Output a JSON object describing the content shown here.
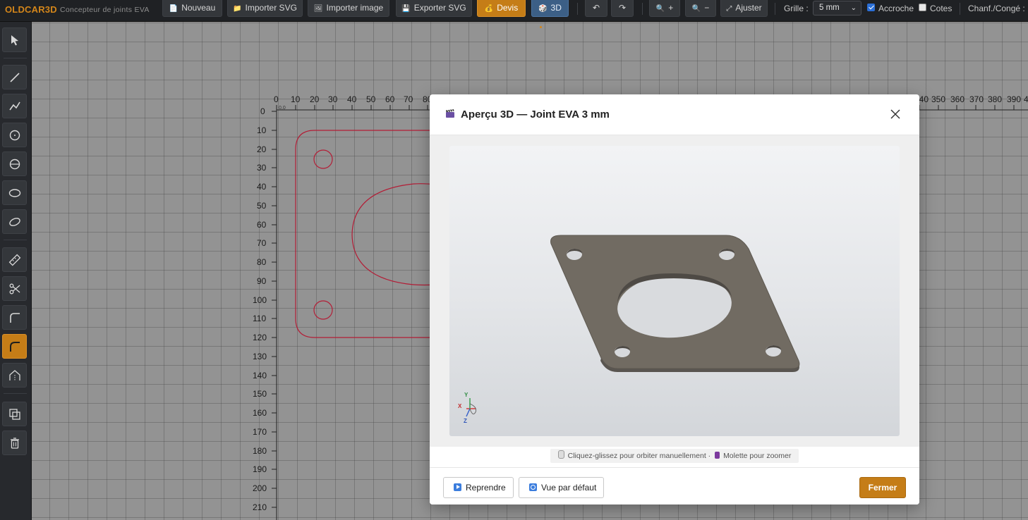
{
  "app": {
    "brand": "OLDCAR3D",
    "subtitle": "Concepteur de joints EVA"
  },
  "toolbar": {
    "new_label": "Nouveau",
    "import_svg_label": "Importer SVG",
    "import_image_label": "Importer image",
    "export_svg_label": "Exporter SVG",
    "quote_label": "Devis",
    "view3d_label": "3D",
    "undo_label": "↶",
    "redo_label": "↷",
    "zoom_in_label": "+",
    "zoom_out_label": "−",
    "fit_label": "Ajuster",
    "grid_label": "Grille :",
    "grid_value": "5 mm",
    "snap_label": "Accroche",
    "snap_checked": true,
    "dims_label": "Cotes",
    "dims_checked": false,
    "chamfer_label": "Chanf./Congé :"
  },
  "sidebar": {
    "tools": [
      {
        "name": "select-tool",
        "icon": "cursor-icon"
      },
      {
        "name": "line-tool",
        "icon": "line-icon"
      },
      {
        "name": "polyline-tool",
        "icon": "polyline-icon"
      },
      {
        "name": "circle-tool",
        "icon": "circle-icon"
      },
      {
        "name": "circle-diameter-tool",
        "icon": "circle-diameter-icon"
      },
      {
        "name": "ellipse-tool",
        "icon": "ellipse-icon"
      },
      {
        "name": "rotated-ellipse-tool",
        "icon": "rotated-ellipse-icon"
      },
      {
        "name": "measure-tool",
        "icon": "ruler-icon"
      },
      {
        "name": "cut-tool",
        "icon": "scissors-icon"
      },
      {
        "name": "fillet-tool",
        "icon": "fillet-icon"
      },
      {
        "name": "round-corner-tool",
        "icon": "round-corner-icon",
        "active": true
      },
      {
        "name": "chamfer-tool",
        "icon": "chamfer-icon"
      },
      {
        "name": "duplicate-tool",
        "icon": "duplicate-icon"
      },
      {
        "name": "delete-tool",
        "icon": "trash-icon"
      }
    ]
  },
  "rulers": {
    "horizontal": [
      "0",
      "10",
      "20",
      "30",
      "40",
      "50",
      "60",
      "70",
      "80",
      "340",
      "350",
      "360",
      "370",
      "380",
      "390",
      "4"
    ],
    "vertical": [
      "0",
      "10",
      "20",
      "30",
      "40",
      "50",
      "60",
      "70",
      "80",
      "90",
      "100",
      "110",
      "120",
      "130",
      "140",
      "150",
      "160",
      "170",
      "180",
      "190",
      "200",
      "210"
    ],
    "origin_label": "0,0"
  },
  "modal": {
    "title": "Aperçu 3D — Joint EVA 3 mm",
    "hint": "Cliquez-glissez pour orbiter manuellement · ",
    "hint2": "Molette pour zoomer",
    "axes": {
      "x": "X",
      "y": "Y",
      "z": "Z"
    },
    "resume_label": "Reprendre",
    "default_view_label": "Vue par défaut",
    "close_label": "Fermer"
  },
  "colors": {
    "accent": "#c57d17",
    "drawing": "#c0213a",
    "gasket": "#716b62"
  }
}
